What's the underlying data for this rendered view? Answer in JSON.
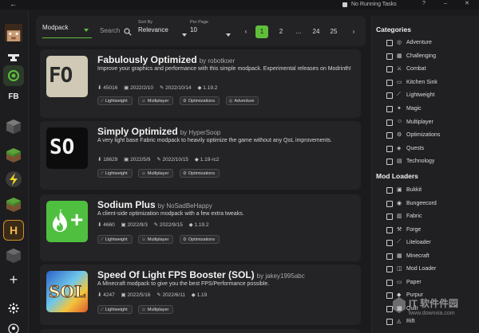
{
  "titlebar": {
    "back_glyph": "←",
    "tasks": "No Running Tasks",
    "help_glyph": "?",
    "minimize_glyph": "–",
    "close_glyph": "✕"
  },
  "leftbar": {
    "icons": [
      "player-head-icon",
      "anvil-icon",
      "modrinth-icon",
      "fabric-logo-icon",
      "grass-block-icon",
      "lightning-icon",
      "grass-block-icon",
      "hyper-icon",
      "add-icon",
      "settings-icon",
      "account-icon"
    ],
    "add_glyph": "+"
  },
  "filters": {
    "type_value": "Modpack",
    "search_placeholder": "Search",
    "sort_label": "Sort By",
    "sort_value": "Relevance",
    "per_page_label": "Per Page",
    "per_page_value": "10",
    "pages": [
      "‹",
      "1",
      "2",
      "...",
      "24",
      "25",
      "›"
    ],
    "active_page": "1"
  },
  "cards": [
    {
      "title": "Fabulously Optimized",
      "author": "by robotkoer",
      "description": "Improve your graphics and performance with this simple modpack. Experimental releases on Modrinth!",
      "downloads": "45016",
      "created": "2022/2/10",
      "updated": "2022/10/14",
      "version": "1.19.2",
      "tags": [
        "Lightweight",
        "Multiplayer",
        "Optimizations",
        "Adventure"
      ],
      "tag_icons": [
        "feather-icon",
        "users-icon",
        "wrench-icon",
        "compass-icon"
      ],
      "thumb_text": "FO"
    },
    {
      "title": "Simply Optimized",
      "author": "by HyperSoop",
      "description": "A very light base Fabric modpack to heavily optimize the game without any QoL improvements.",
      "downloads": "18629",
      "created": "2022/5/9",
      "updated": "2022/10/15",
      "version": "1.19-rc2",
      "tags": [
        "Lightweight",
        "Multiplayer",
        "Optimizations"
      ],
      "tag_icons": [
        "feather-icon",
        "users-icon",
        "wrench-icon"
      ],
      "thumb_text": "SO"
    },
    {
      "title": "Sodium Plus",
      "author": "by NoSadBeHappy",
      "description": "A client-side optimization modpack with a few extra tweaks.",
      "downloads": "4660",
      "created": "2022/9/3",
      "updated": "2022/9/15",
      "version": "1.19.2",
      "tags": [
        "Lightweight",
        "Multiplayer",
        "Optimizations"
      ],
      "tag_icons": [
        "feather-icon",
        "users-icon",
        "wrench-icon"
      ],
      "thumb_text": "+"
    },
    {
      "title": "Speed Of Light FPS Booster (SOL)",
      "author": "by jakey1995abc",
      "description": "A Minecraft modpack to give you the best FPS/Performance possible.",
      "downloads": "4247",
      "created": "2022/5/16",
      "updated": "2022/6/11",
      "version": "1.19",
      "tags": [
        "Lightweight",
        "Multiplayer"
      ],
      "tag_icons": [
        "feather-icon",
        "users-icon"
      ],
      "thumb_text": "SOL"
    }
  ],
  "categories": {
    "heading": "Categories",
    "items": [
      {
        "label": "Adventure",
        "icon": "compass-icon",
        "glyph": "◎"
      },
      {
        "label": "Challenging",
        "icon": "chart-icon",
        "glyph": "▦"
      },
      {
        "label": "Combat",
        "icon": "swords-icon",
        "glyph": "⚔"
      },
      {
        "label": "Kitchen Sink",
        "icon": "sink-icon",
        "glyph": "▭"
      },
      {
        "label": "Lightweight",
        "icon": "feather-icon",
        "glyph": "⟋"
      },
      {
        "label": "Magic",
        "icon": "wand-icon",
        "glyph": "✦"
      },
      {
        "label": "Multiplayer",
        "icon": "users-icon",
        "glyph": "☺"
      },
      {
        "label": "Optimizations",
        "icon": "wrench-icon",
        "glyph": "⚙"
      },
      {
        "label": "Quests",
        "icon": "compass-icon",
        "glyph": "◈"
      },
      {
        "label": "Technology",
        "icon": "server-icon",
        "glyph": "▤"
      }
    ]
  },
  "mod_loaders": {
    "heading": "Mod Loaders",
    "items": [
      {
        "label": "Bukkit",
        "icon": "bukkit-icon",
        "glyph": "▣"
      },
      {
        "label": "Bungeecord",
        "icon": "bungeecord-icon",
        "glyph": "◉"
      },
      {
        "label": "Fabric",
        "icon": "fabric-icon",
        "glyph": "▥"
      },
      {
        "label": "Forge",
        "icon": "forge-icon",
        "glyph": "⚒"
      },
      {
        "label": "Liteloader",
        "icon": "liteloader-icon",
        "glyph": "⟋"
      },
      {
        "label": "Minecraft",
        "icon": "minecraft-icon",
        "glyph": "▦"
      },
      {
        "label": "Mod Loader",
        "icon": "modloader-icon",
        "glyph": "◫"
      },
      {
        "label": "Paper",
        "icon": "paper-icon",
        "glyph": "▭"
      },
      {
        "label": "Purpur",
        "icon": "purpur-icon",
        "glyph": "◆"
      },
      {
        "label": "Quilt",
        "icon": "quilt-icon",
        "glyph": "▩"
      },
      {
        "label": "Rift",
        "icon": "rift-icon",
        "glyph": "◬"
      }
    ]
  },
  "watermark": {
    "text": "IT 软件件园",
    "url": "www.downxia.com"
  },
  "colors": {
    "accent": "#5fbf3c",
    "background": "#1b1b1d",
    "card": "#242426"
  }
}
